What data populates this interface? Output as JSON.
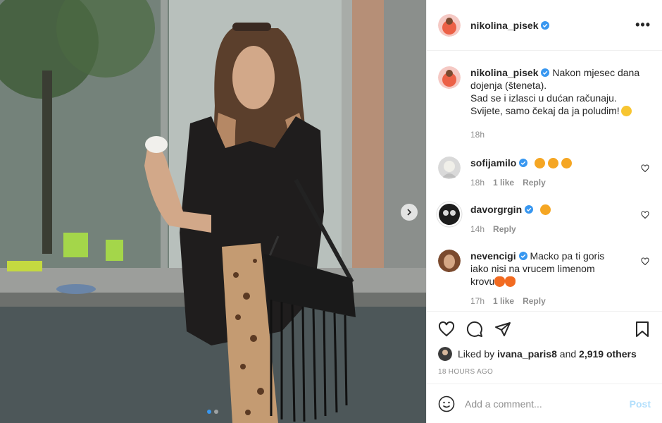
{
  "post": {
    "author": "nikolina_pisek",
    "more_icon": "more-dots-icon",
    "caption": {
      "user": "nikolina_pisek",
      "lines": [
        "Nakon mjesec dana",
        "dojenja (šteneta).",
        "Sad se i izlasci u dućan računaju.",
        "Svijete, samo čekaj da ja poludim!"
      ],
      "time": "18h"
    },
    "comments": [
      {
        "user": "sofijamilo",
        "time": "18h",
        "likes": "1 like",
        "reply": "Reply"
      },
      {
        "user": "davorgrgin",
        "time": "14h",
        "reply": "Reply"
      },
      {
        "user": "nevencigi",
        "text_lines": [
          "Macko pa ti goris",
          "iako nisi na vrucem limenom",
          "krovu"
        ],
        "time": "17h",
        "likes": "1 like",
        "reply": "Reply"
      }
    ],
    "liked_by_prefix": "Liked by",
    "liked_by_user": "ivana_paris8",
    "liked_by_and": "and",
    "liked_by_others": "2,919 others",
    "posted_ago": "18 HOURS AGO",
    "add_comment_placeholder": "Add a comment...",
    "post_button": "Post",
    "carousel": {
      "current": 1,
      "total": 2
    }
  },
  "colors": {
    "verified": "#3897f0",
    "link_blue": "#b2dffc",
    "muted": "#8e8e8e"
  }
}
